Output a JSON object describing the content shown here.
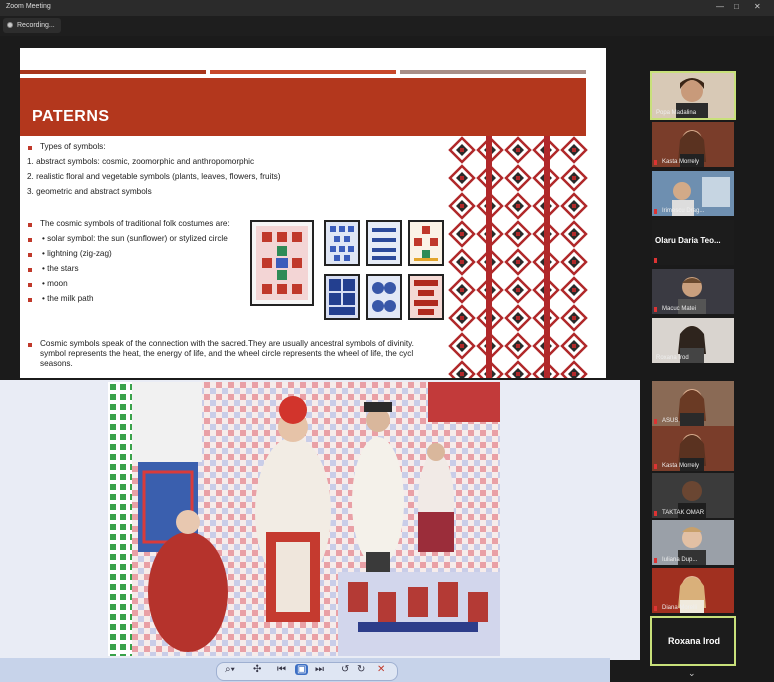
{
  "window": {
    "title": "Zoom Meeting",
    "controls": [
      "—",
      "□",
      "✕"
    ]
  },
  "recording": {
    "label": "Recording..."
  },
  "slide": {
    "title": "PATERNS",
    "lines": [
      "Types of symbols:",
      "1. abstract symbols: cosmic, zoomorphic and anthropomorphic",
      "2. realistic floral and vegetable symbols (plants, leaves, flowers, fruits)",
      "3. geometric and abstract symbols"
    ],
    "cosmic_heading": "The cosmic symbols of traditional folk costumes are:",
    "cosmic_items": [
      "• solar symbol: the sun (sunflower) or stylized circle",
      "• lightning (zig-zag)",
      "• the stars",
      "• moon",
      "• the milk path"
    ],
    "footer_lines": [
      "Cosmic symbols speak of the connection with the sacred.They are usually ancestral symbols of divinity.",
      "symbol represents the heat, the energy of life, and the wheel circle represents the wheel of life, the cycl",
      "seasons."
    ]
  },
  "colors": {
    "accent": "#b3371d",
    "stripe1": "#a8361c",
    "stripe2": "#c8482a",
    "stripe3": "#a88f88",
    "active_border": "#c8e07a"
  },
  "participants": [
    {
      "name": "Popa Madalina",
      "active": true
    },
    {
      "name": "Kasta Morrely",
      "active": false
    },
    {
      "name": "Irimescu Drag...",
      "active": false
    },
    {
      "name": "Olaru Daria Teo...",
      "active": false,
      "name_only": true
    },
    {
      "name": "Macuc Matei",
      "active": false
    },
    {
      "name": "Roxana Irod",
      "active": false
    },
    {
      "name": "ASUS",
      "active": false
    },
    {
      "name": "Kasta Morrely",
      "active": false
    },
    {
      "name": "TAKTAK OMAR",
      "active": false
    },
    {
      "name": "Iuliana Dup...",
      "active": false
    },
    {
      "name": "Diana Morelli",
      "active": false
    },
    {
      "name": "Roxana Irod",
      "active": true,
      "name_only": true
    }
  ],
  "toolbar": {
    "icons": [
      "zoom-icon",
      "pan-icon",
      "prev-icon",
      "fit-icon",
      "next-icon",
      "rotate-left-icon",
      "rotate-right-icon",
      "close-icon"
    ]
  }
}
